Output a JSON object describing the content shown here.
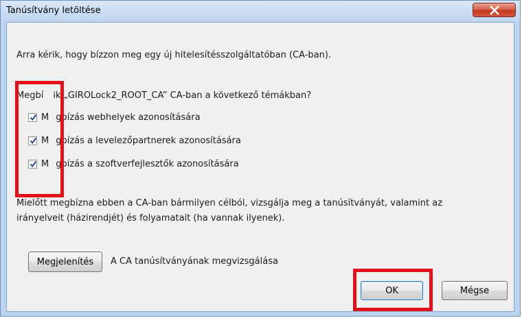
{
  "window": {
    "title": "Tanúsítvány letöltése",
    "close_glyph": "X"
  },
  "dialog": {
    "intro": "Arra kérik, hogy bízzon meg egy új hitelesítésszolgáltatóban (CA-ban).",
    "question_prefix": "Megbí",
    "question_suffix": "ik „GIROLock2_ROOT_CA” CA-ban a következő témákban?",
    "options": [
      {
        "prefix": "M",
        "suffix": "gbízás webhelyek azonosítására",
        "checked": true
      },
      {
        "prefix": "M",
        "suffix": "gbízás a levelezőpartnerek azonosítására",
        "checked": true
      },
      {
        "prefix": "M",
        "suffix": "gbízás a szoftverfejlesztők azonosítására",
        "checked": true
      }
    ],
    "warning_line1_prefix": "Mielőtt",
    "warning_line1_suffix": "megbízna ebben a CA-ban bármilyen célból, vizsgálja meg a tanúsítványát, valamint az",
    "warning_line2": "irányelveit (házirendjét) és folyamatait (ha vannak ilyenek).",
    "view_button": "Megjelenítés",
    "view_desc": "A CA tanúsítványának megvizsgálása",
    "ok_button": "OK",
    "cancel_button": "Mégse"
  },
  "colors": {
    "highlight": "#e1101b",
    "checkmark": "#2b4a8a",
    "title_bar": "#c4d9f1"
  }
}
